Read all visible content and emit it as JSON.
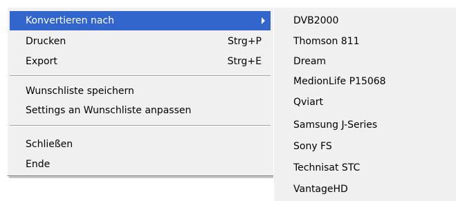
{
  "main_menu": {
    "convert_to": {
      "label": "Konvertieren nach"
    },
    "print": {
      "label": "Drucken",
      "shortcut": "Strg+P"
    },
    "export": {
      "label": "Export",
      "shortcut": "Strg+E"
    },
    "save_wishlist": {
      "label": "Wunschliste speichern"
    },
    "adjust_settings": {
      "label": "Settings an Wunschliste anpassen"
    },
    "close": {
      "label": "Schließen"
    },
    "exit": {
      "label": "Ende"
    }
  },
  "submenu": {
    "items": [
      {
        "label": "DVB2000"
      },
      {
        "label": "Thomson 811"
      },
      {
        "label": "Dream"
      },
      {
        "label": "MedionLife P15068"
      },
      {
        "label": "Qviart"
      },
      {
        "label": "Samsung J-Series"
      },
      {
        "label": "Sony FS"
      },
      {
        "label": "Technisat STC"
      },
      {
        "label": "VantageHD"
      }
    ]
  },
  "colors": {
    "menu_background": "#f0f0f0",
    "selection": "#3366cc",
    "selection_text": "#ffffff"
  }
}
